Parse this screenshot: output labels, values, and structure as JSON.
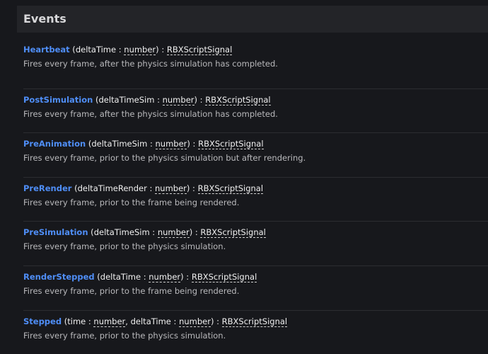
{
  "section_title": "Events",
  "events": [
    {
      "name": "Heartbeat",
      "params": [
        {
          "name": "deltaTime",
          "type": "number"
        }
      ],
      "returns": "RBXScriptSignal",
      "description": "Fires every frame, after the physics simulation has completed."
    },
    {
      "name": "PostSimulation",
      "params": [
        {
          "name": "deltaTimeSim",
          "type": "number"
        }
      ],
      "returns": "RBXScriptSignal",
      "description": "Fires every frame, after the physics simulation has completed."
    },
    {
      "name": "PreAnimation",
      "params": [
        {
          "name": "deltaTimeSim",
          "type": "number"
        }
      ],
      "returns": "RBXScriptSignal",
      "description": "Fires every frame, prior to the physics simulation but after rendering."
    },
    {
      "name": "PreRender",
      "params": [
        {
          "name": "deltaTimeRender",
          "type": "number"
        }
      ],
      "returns": "RBXScriptSignal",
      "description": "Fires every frame, prior to the frame being rendered."
    },
    {
      "name": "PreSimulation",
      "params": [
        {
          "name": "deltaTimeSim",
          "type": "number"
        }
      ],
      "returns": "RBXScriptSignal",
      "description": "Fires every frame, prior to the physics simulation."
    },
    {
      "name": "RenderStepped",
      "params": [
        {
          "name": "deltaTime",
          "type": "number"
        }
      ],
      "returns": "RBXScriptSignal",
      "description": "Fires every frame, prior to the frame being rendered."
    },
    {
      "name": "Stepped",
      "params": [
        {
          "name": "time",
          "type": "number"
        },
        {
          "name": "deltaTime",
          "type": "number"
        }
      ],
      "returns": "RBXScriptSignal",
      "description": "Fires every frame, prior to the physics simulation."
    }
  ]
}
